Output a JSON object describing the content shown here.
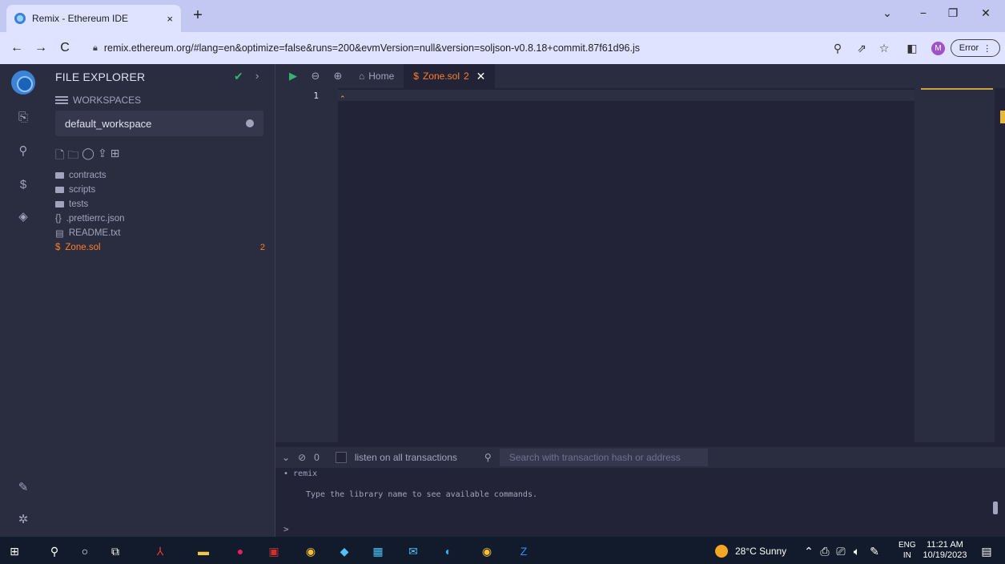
{
  "browser": {
    "tab_title": "Remix - Ethereum IDE",
    "tab_close": "×",
    "new_tab": "+",
    "window_controls": [
      "⌄",
      "−",
      "❐",
      "✕"
    ],
    "url": "remix.ethereum.org/#lang=en&optimize=false&runs=200&evmVersion=null&version=soljson-v0.8.18+commit.87f61d96.js",
    "profile_initial": "M",
    "error_label": "Error"
  },
  "sidebar": {
    "title": "FILE EXPLORER",
    "workspaces_label": "WORKSPACES",
    "workspace_selected": "default_workspace",
    "tree": [
      {
        "name": "contracts",
        "type": "folder"
      },
      {
        "name": "scripts",
        "type": "folder"
      },
      {
        "name": "tests",
        "type": "folder"
      },
      {
        "name": ".prettierrc.json",
        "type": "json"
      },
      {
        "name": "README.txt",
        "type": "txt"
      },
      {
        "name": "Zone.sol",
        "type": "sol",
        "badge": "2"
      }
    ]
  },
  "editor": {
    "home_tab": "Home",
    "file_tab": "Zone.sol",
    "file_tab_count": "2",
    "line_number": "1"
  },
  "terminal": {
    "tx_count": "0",
    "listen_label": "listen on all transactions",
    "search_placeholder": "Search with transaction hash or address",
    "line_remix": "• remix",
    "line_hint": "Type the library name to see available commands.",
    "prompt": ">"
  },
  "taskbar": {
    "weather": "28°C  Sunny",
    "lang_top": "ENG",
    "lang_bottom": "IN",
    "time": "11:21 AM",
    "date": "10/19/2023"
  },
  "colors": {
    "accent_orange": "#ff7f27",
    "success_green": "#36b370",
    "background": "#222336"
  }
}
